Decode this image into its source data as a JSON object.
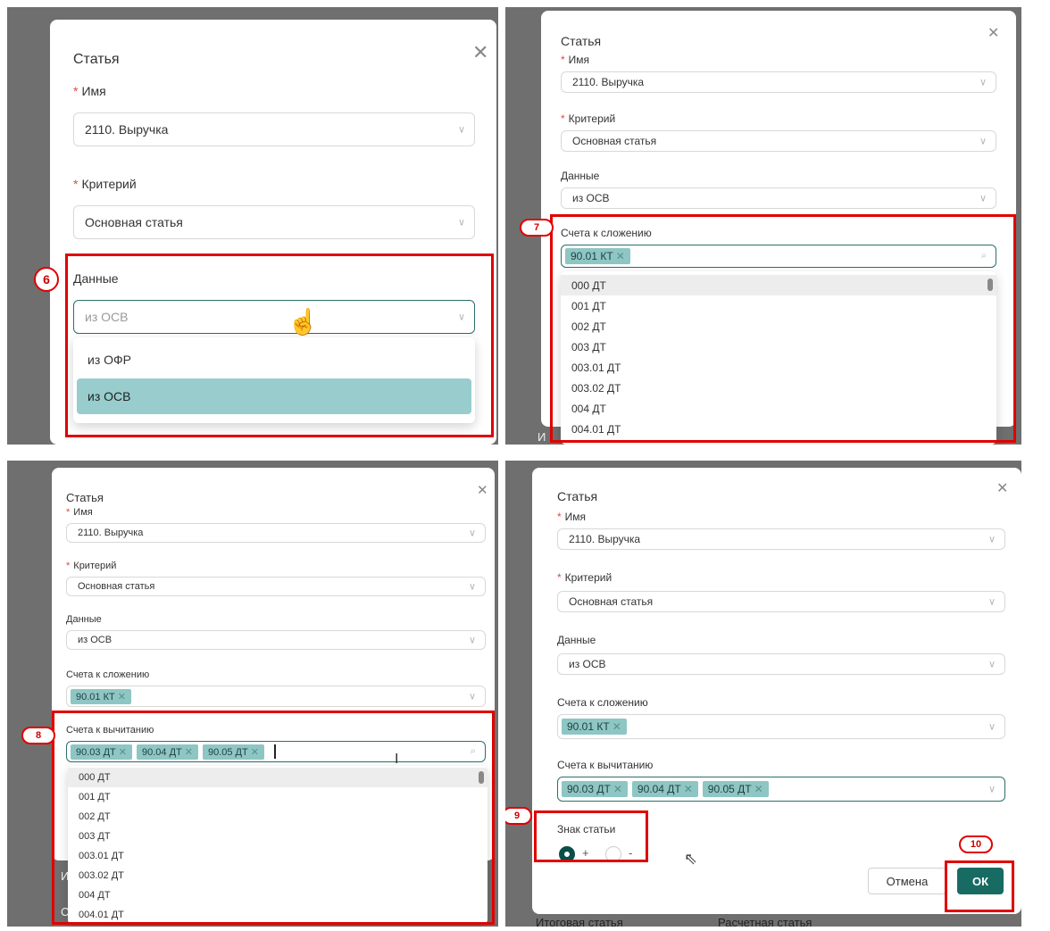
{
  "dialog_title": "Статья",
  "labels": {
    "name": "Имя",
    "criterion": "Критерий",
    "data": "Данные",
    "add_accounts": "Счета к сложению",
    "sub_accounts": "Счета к вычитанию",
    "sign": "Знак статьи",
    "required_mark": "*"
  },
  "values": {
    "name": "2110. Выручка",
    "criterion": "Основная статья",
    "data": "из ОСВ"
  },
  "icons": {
    "close": "close-icon",
    "chevron": "chevron-down-icon",
    "search": "search-icon"
  },
  "panel1": {
    "step": "6",
    "data_options": [
      "из ОФР",
      "из ОСВ"
    ]
  },
  "panel2": {
    "step": "7",
    "add_tags": [
      "90.01 КТ"
    ],
    "options": [
      "000 ДТ",
      "001 ДТ",
      "002 ДТ",
      "003 ДТ",
      "003.01 ДТ",
      "003.02 ДТ",
      "004 ДТ",
      "004.01 ДТ"
    ],
    "bg_text": "И"
  },
  "panel3": {
    "step": "8",
    "add_tags": [
      "90.01 КТ"
    ],
    "sub_tags": [
      "90.03 ДТ",
      "90.04 ДТ",
      "90.05 ДТ"
    ],
    "options": [
      "000 ДТ",
      "001 ДТ",
      "002 ДТ",
      "003 ДТ",
      "003.01 ДТ",
      "003.02 ДТ",
      "004 ДТ",
      "004.01 ДТ"
    ],
    "bg_text_1": "И",
    "bg_text_2": "С"
  },
  "panel4": {
    "step_sign": "9",
    "step_ok": "10",
    "add_tags": [
      "90.01 КТ"
    ],
    "sub_tags": [
      "90.03 ДТ",
      "90.04 ДТ",
      "90.05 ДТ"
    ],
    "sign_plus": "+",
    "sign_minus": "-",
    "cancel": "Отмена",
    "ok": "ОК",
    "footer_col1": "Итоговая статья",
    "footer_col2": "Расчетная статья"
  },
  "colors": {
    "accent": "#176b62",
    "tag": "#8ec6c4",
    "highlight": "#e00000"
  }
}
